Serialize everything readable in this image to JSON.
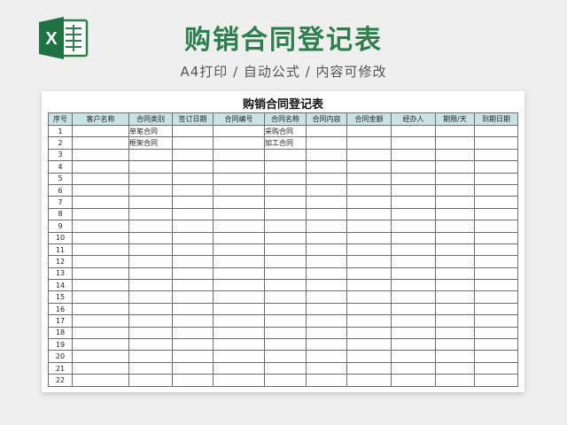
{
  "header": {
    "title": "购销合同登记表",
    "subtitle": "A4打印 / 自动公式 / 内容可修改",
    "logo_icon": "excel-icon",
    "logo_letter": "X"
  },
  "sheet": {
    "title": "购销合同登记表",
    "columns": [
      "序号",
      "客户名称",
      "合同类别",
      "签订日期",
      "合同编号",
      "合同名称",
      "合同内容",
      "合同金额",
      "经办人",
      "期限/天",
      "到期日期"
    ],
    "rows": [
      [
        "1",
        "",
        "单笔合同",
        "",
        "",
        "采购合同",
        "",
        "",
        "",
        "",
        ""
      ],
      [
        "2",
        "",
        "框架合同",
        "",
        "",
        "加工合同",
        "",
        "",
        "",
        "",
        ""
      ],
      [
        "3",
        "",
        "",
        "",
        "",
        "",
        "",
        "",
        "",
        "",
        ""
      ],
      [
        "4",
        "",
        "",
        "",
        "",
        "",
        "",
        "",
        "",
        "",
        ""
      ],
      [
        "5",
        "",
        "",
        "",
        "",
        "",
        "",
        "",
        "",
        "",
        ""
      ],
      [
        "6",
        "",
        "",
        "",
        "",
        "",
        "",
        "",
        "",
        "",
        ""
      ],
      [
        "7",
        "",
        "",
        "",
        "",
        "",
        "",
        "",
        "",
        "",
        ""
      ],
      [
        "8",
        "",
        "",
        "",
        "",
        "",
        "",
        "",
        "",
        "",
        ""
      ],
      [
        "9",
        "",
        "",
        "",
        "",
        "",
        "",
        "",
        "",
        "",
        ""
      ],
      [
        "10",
        "",
        "",
        "",
        "",
        "",
        "",
        "",
        "",
        "",
        ""
      ],
      [
        "11",
        "",
        "",
        "",
        "",
        "",
        "",
        "",
        "",
        "",
        ""
      ],
      [
        "12",
        "",
        "",
        "",
        "",
        "",
        "",
        "",
        "",
        "",
        ""
      ],
      [
        "13",
        "",
        "",
        "",
        "",
        "",
        "",
        "",
        "",
        "",
        ""
      ],
      [
        "14",
        "",
        "",
        "",
        "",
        "",
        "",
        "",
        "",
        "",
        ""
      ],
      [
        "15",
        "",
        "",
        "",
        "",
        "",
        "",
        "",
        "",
        "",
        ""
      ],
      [
        "16",
        "",
        "",
        "",
        "",
        "",
        "",
        "",
        "",
        "",
        ""
      ],
      [
        "17",
        "",
        "",
        "",
        "",
        "",
        "",
        "",
        "",
        "",
        ""
      ],
      [
        "18",
        "",
        "",
        "",
        "",
        "",
        "",
        "",
        "",
        "",
        ""
      ],
      [
        "19",
        "",
        "",
        "",
        "",
        "",
        "",
        "",
        "",
        "",
        ""
      ],
      [
        "20",
        "",
        "",
        "",
        "",
        "",
        "",
        "",
        "",
        "",
        ""
      ],
      [
        "21",
        "",
        "",
        "",
        "",
        "",
        "",
        "",
        "",
        "",
        ""
      ],
      [
        "22",
        "",
        "",
        "",
        "",
        "",
        "",
        "",
        "",
        "",
        ""
      ]
    ]
  },
  "colors": {
    "brand_green": "#2f7f4e",
    "header_fill": "#c9e3e4"
  }
}
